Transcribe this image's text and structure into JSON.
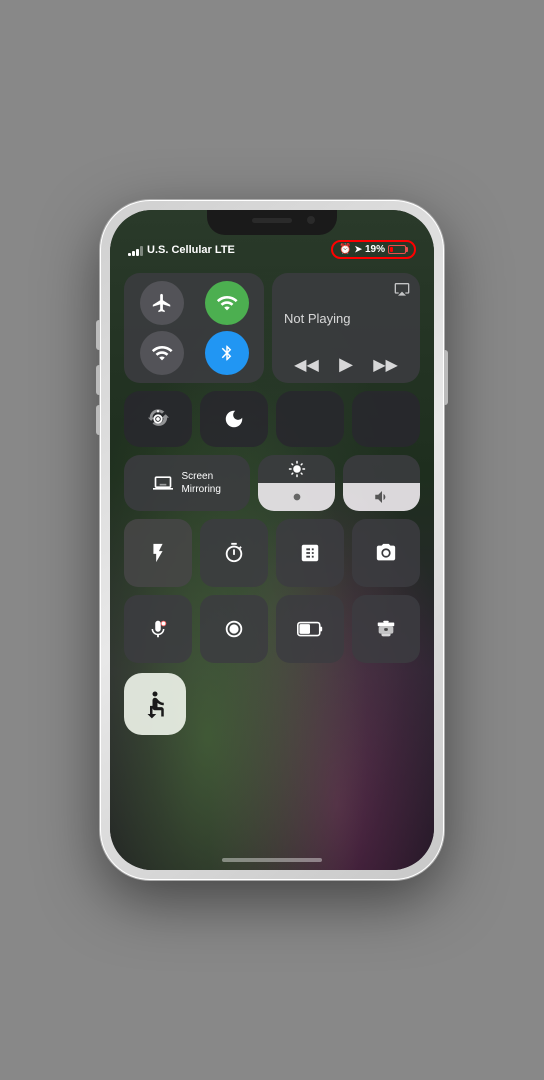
{
  "phone": {
    "status_bar": {
      "carrier": "U.S. Cellular LTE",
      "battery_percent": "19%",
      "alarm_icon": "⏰",
      "location_icon": "➤"
    },
    "media_player": {
      "not_playing_label": "Not Playing",
      "airplay_label": "AirPlay"
    },
    "connectivity": {
      "airplane_label": "Airplane Mode",
      "wifi_label": "Wi-Fi",
      "signal_label": "Cellular",
      "bluetooth_label": "Bluetooth"
    },
    "controls": {
      "rotation_lock_label": "Rotation Lock",
      "do_not_disturb_label": "Do Not Disturb",
      "brightness_label": "Brightness",
      "volume_label": "Volume",
      "screen_mirror_label": "Screen\nMirroring"
    },
    "apps": {
      "flashlight_label": "Flashlight",
      "timer_label": "Timer",
      "calculator_label": "Calculator",
      "camera_label": "Camera",
      "voice_memos_label": "Voice Memos",
      "screen_record_label": "Screen Recording",
      "battery_label": "Low Power Mode",
      "sleep_label": "Sleep",
      "accessibility_label": "Accessibility Shortcut"
    },
    "media_controls": {
      "prev": "⏮",
      "play": "▶",
      "next": "⏭"
    }
  }
}
